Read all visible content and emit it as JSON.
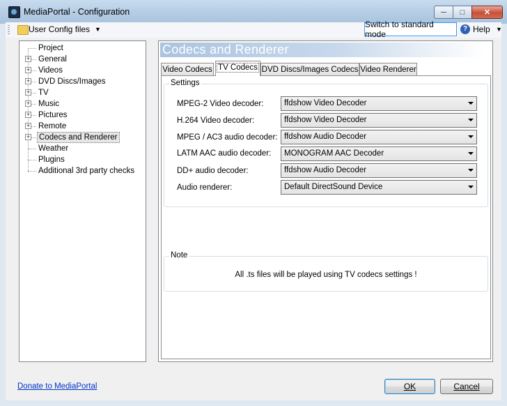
{
  "window": {
    "title": "MediaPortal - Configuration"
  },
  "toolbar": {
    "config_label": "User Config files",
    "switch_label": "Switch to standard mode",
    "help_label": "Help"
  },
  "tree": {
    "items": [
      {
        "label": "Project",
        "expandable": false
      },
      {
        "label": "General",
        "expandable": true
      },
      {
        "label": "Videos",
        "expandable": true
      },
      {
        "label": "DVD Discs/Images",
        "expandable": true
      },
      {
        "label": "TV",
        "expandable": true
      },
      {
        "label": "Music",
        "expandable": true
      },
      {
        "label": "Pictures",
        "expandable": true
      },
      {
        "label": "Remote",
        "expandable": true
      },
      {
        "label": "Codecs and Renderer",
        "expandable": true,
        "selected": true
      },
      {
        "label": "Weather",
        "expandable": false
      },
      {
        "label": "Plugins",
        "expandable": false
      },
      {
        "label": "Additional 3rd party checks",
        "expandable": false
      }
    ]
  },
  "panel": {
    "title": "Codecs and Renderer",
    "tabs": [
      {
        "label": "Video Codecs",
        "active": false
      },
      {
        "label": "TV Codecs",
        "active": true
      },
      {
        "label": "DVD Discs/Images Codecs",
        "active": false
      },
      {
        "label": "Video Renderer",
        "active": false
      }
    ],
    "settings": {
      "group_title": "Settings",
      "rows": [
        {
          "label": "MPEG-2 Video decoder:",
          "value": "ffdshow Video Decoder"
        },
        {
          "label": "H.264 Video decoder:",
          "value": "ffdshow Video Decoder"
        },
        {
          "label": "MPEG / AC3 audio decoder:",
          "value": "ffdshow Audio Decoder"
        },
        {
          "label": "LATM AAC audio decoder:",
          "value": "MONOGRAM AAC Decoder"
        },
        {
          "label": "DD+ audio decoder:",
          "value": "ffdshow Audio Decoder"
        },
        {
          "label": "Audio renderer:",
          "value": "Default DirectSound Device"
        }
      ]
    },
    "note": {
      "group_title": "Note",
      "text": "All .ts files will be played using TV codecs settings !"
    }
  },
  "footer": {
    "donate_link": "Donate to MediaPortal",
    "ok_label": "OK",
    "cancel_label": "Cancel"
  },
  "colors": {
    "header_gradient_start": "#aac3e0",
    "link": "#0033cc",
    "titlebar": "#b8cfe6"
  }
}
